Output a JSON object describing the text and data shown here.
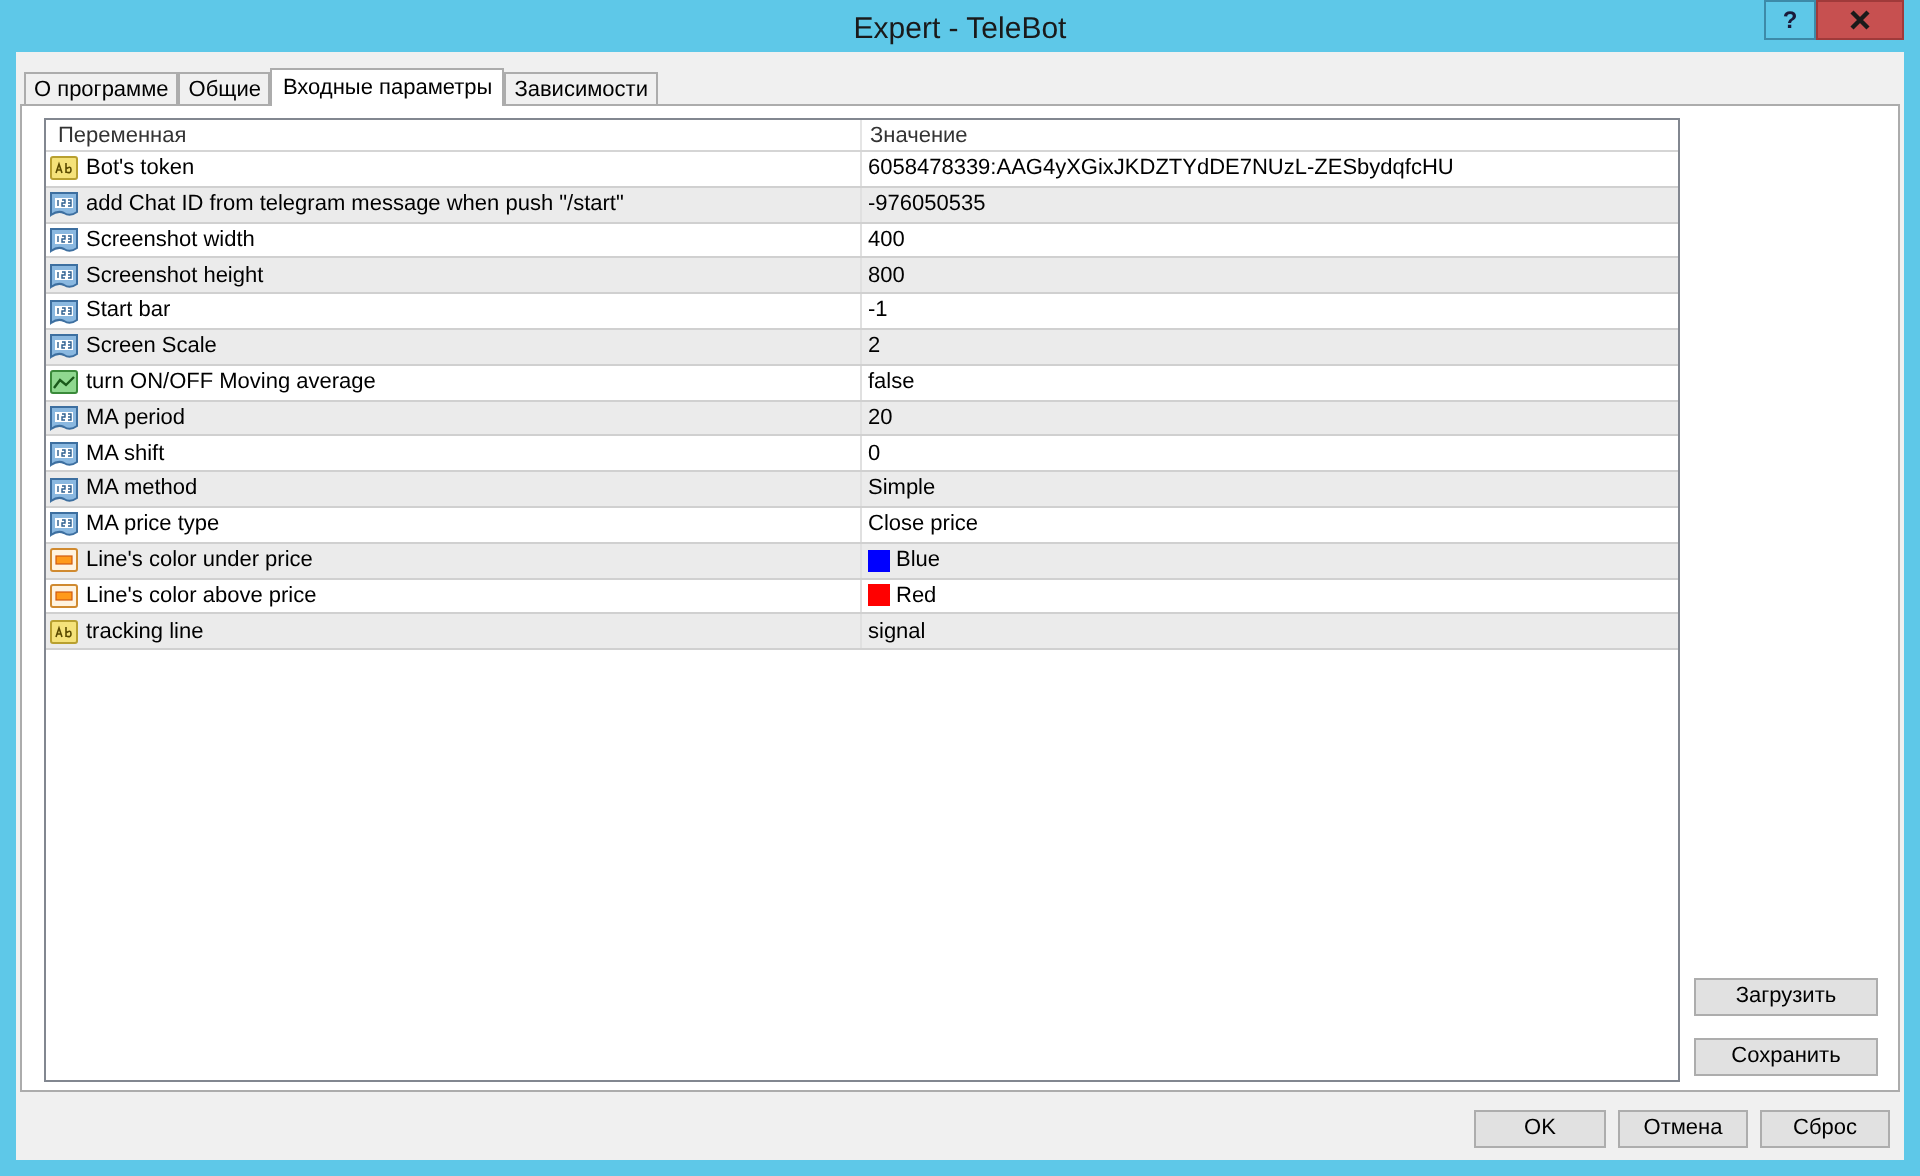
{
  "window": {
    "title": "Expert - TeleBot",
    "help": "?"
  },
  "tabs": [
    {
      "label": "О программе",
      "selected": false
    },
    {
      "label": "Общие",
      "selected": false
    },
    {
      "label": "Входные параметры",
      "selected": true
    },
    {
      "label": "Зависимости",
      "selected": false
    }
  ],
  "table": {
    "columns": [
      "Переменная",
      "Значение"
    ],
    "rows": [
      {
        "kind": "string",
        "variable": "Bot's token",
        "value": "6058478339:AAG4yXGixJKDZTYdDE7NUzL-ZESbydqfcHU"
      },
      {
        "kind": "number",
        "variable": "add Chat ID from telegram message when push \"/start\"",
        "value": "-976050535"
      },
      {
        "kind": "number",
        "variable": "Screenshot width",
        "value": "400"
      },
      {
        "kind": "number",
        "variable": "Screenshot height",
        "value": "800"
      },
      {
        "kind": "number",
        "variable": "Start bar",
        "value": "-1"
      },
      {
        "kind": "number",
        "variable": "Screen Scale",
        "value": "2"
      },
      {
        "kind": "bool",
        "variable": "turn ON/OFF Moving average",
        "value": "false"
      },
      {
        "kind": "number",
        "variable": "MA period",
        "value": "20"
      },
      {
        "kind": "number",
        "variable": "MA shift",
        "value": "0"
      },
      {
        "kind": "number",
        "variable": "MA method",
        "value": "Simple"
      },
      {
        "kind": "number",
        "variable": "MA price type",
        "value": "Close price"
      },
      {
        "kind": "color",
        "variable": "Line's color under price",
        "value": "Blue",
        "color": "#0000ff"
      },
      {
        "kind": "color",
        "variable": "Line's color above price",
        "value": "Red",
        "color": "#ff0000"
      },
      {
        "kind": "string",
        "variable": "tracking line",
        "value": "signal"
      }
    ]
  },
  "side_buttons": [
    "Загрузить",
    "Сохранить"
  ],
  "bottom_buttons": [
    "OK",
    "Отмена",
    "Сброс"
  ]
}
